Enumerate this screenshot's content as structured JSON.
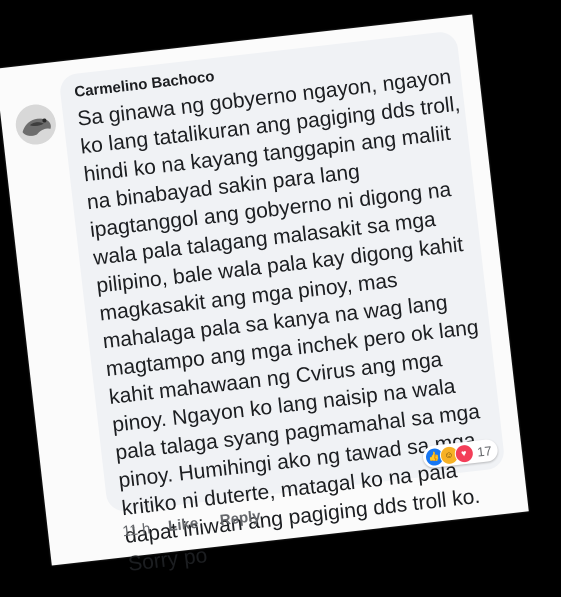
{
  "comment": {
    "author": "Carmelino Bachoco",
    "lines": [
      "Sa ginawa ng gobyerno ngayon, ngayon",
      "ko lang tatalikuran ang pagiging dds troll,",
      "hindi ko na kayang tanggapin ang maliit",
      "na binabayad sakin para lang",
      "ipagtanggol ang gobyerno ni digong na",
      "wala pala talagang malasakit sa mga",
      "pilipino, bale wala pala kay digong kahit",
      "magkasakit ang mga pinoy, mas",
      "mahalaga pala sa kanya na wag lang",
      "magtampo ang mga inchek pero ok lang",
      "kahit mahawaan ng Cvirus ang mga",
      "pinoy. Ngayon ko lang naisip na wala",
      "pala talaga syang pagmamahal sa mga",
      "pinoy. Humihingi ako ng tawad sa mga",
      "kritiko ni duterte, matagal ko na pala",
      "dapat iniwan ang pagiging dds troll ko.",
      "Sorry po"
    ],
    "reactions": {
      "icons": [
        "like-icon",
        "haha-icon",
        "love-icon"
      ],
      "count": "17"
    },
    "time": "11 h",
    "like_label": "Like",
    "reply_label": "Reply"
  },
  "colors": {
    "background": "#000000",
    "card": "#fbfbfb",
    "bubble": "#f0f2f5",
    "text": "#1c1e21",
    "muted": "#65676b",
    "like": "#1877f2",
    "haha": "#f7b125",
    "love": "#f33e58"
  }
}
